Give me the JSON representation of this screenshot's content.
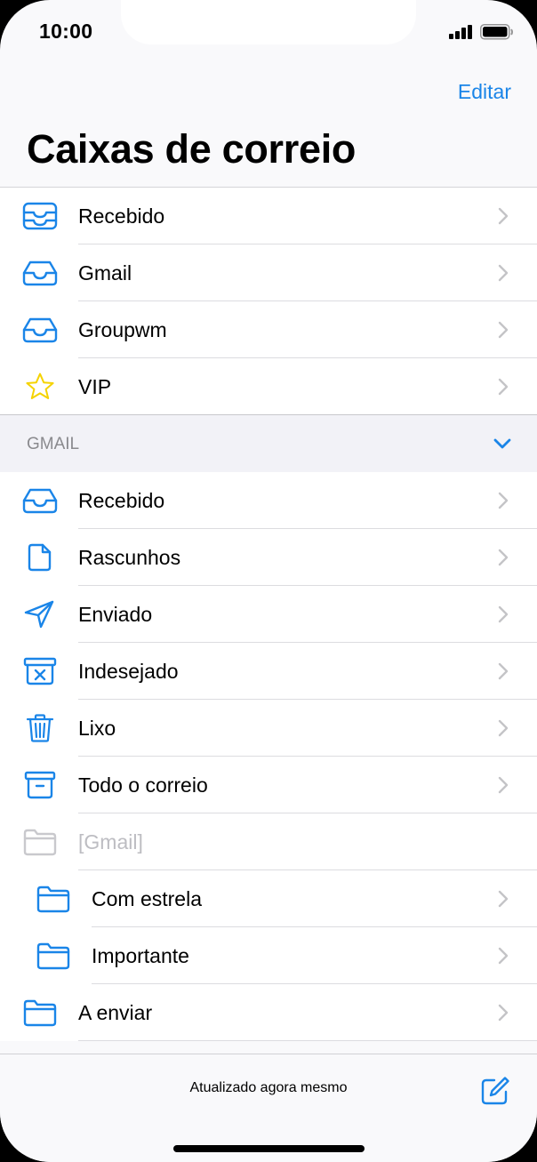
{
  "status_bar": {
    "time": "10:00"
  },
  "header": {
    "edit_label": "Editar",
    "title": "Caixas de correio"
  },
  "top_list": [
    {
      "label": "Recebido",
      "icon": "inbox-all-icon"
    },
    {
      "label": "Gmail",
      "icon": "inbox-icon"
    },
    {
      "label": "Groupwm",
      "icon": "inbox-icon"
    },
    {
      "label": "VIP",
      "icon": "star-icon"
    }
  ],
  "gmail_section": {
    "title": "GMAIL",
    "items": [
      {
        "label": "Recebido",
        "icon": "inbox-icon"
      },
      {
        "label": "Rascunhos",
        "icon": "document-icon"
      },
      {
        "label": "Enviado",
        "icon": "paper-plane-icon"
      },
      {
        "label": "Indesejado",
        "icon": "junk-icon"
      },
      {
        "label": "Lixo",
        "icon": "trash-icon"
      },
      {
        "label": "Todo o correio",
        "icon": "archive-icon"
      },
      {
        "label": "[Gmail]",
        "icon": "folder-icon"
      },
      {
        "label": "Com estrela",
        "icon": "folder-icon"
      },
      {
        "label": "Importante",
        "icon": "folder-icon"
      },
      {
        "label": "A enviar",
        "icon": "folder-icon"
      }
    ]
  },
  "toolbar": {
    "status": "Atualizado agora mesmo",
    "compose_icon": "compose-icon"
  },
  "colors": {
    "accent": "#1a85e8",
    "star": "#f5d300",
    "disabled": "#bdbdc2",
    "section_bg": "#f2f2f7"
  }
}
